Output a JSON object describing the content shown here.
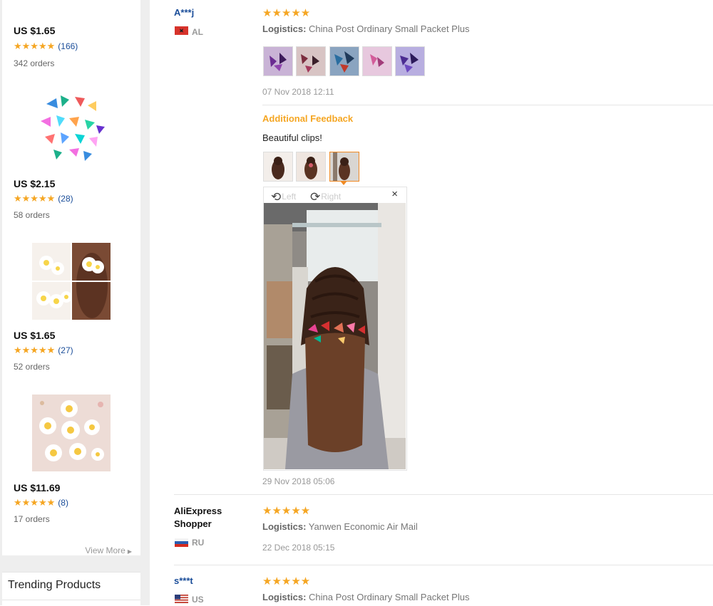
{
  "sidebar": {
    "products": [
      {
        "price": "US $1.65",
        "stars": "★★★★★",
        "review_count": "(166)",
        "orders": "342 orders"
      },
      {
        "price": "US $2.15",
        "stars": "★★★★★",
        "review_count": "(28)",
        "orders": "58 orders"
      },
      {
        "price": "US $1.65",
        "stars": "★★★★★",
        "review_count": "(27)",
        "orders": "52 orders"
      },
      {
        "price": "US $11.69",
        "stars": "★★★★★",
        "review_count": "(8)",
        "orders": "17 orders"
      }
    ],
    "view_more": "View More",
    "trending_title": "Trending Products"
  },
  "reviews": [
    {
      "name": "A***j",
      "country": "AL",
      "stars": "★★★★★",
      "logistics_label": "Logistics:",
      "logistics": "China Post Ordinary Small Packet Plus",
      "date": "07 Nov 2018 12:11",
      "additional_feedback_label": "Additional Feedback",
      "additional_text": "Beautiful clips!",
      "viewer": {
        "left_label": "Left",
        "right_label": "Right",
        "close": "×"
      },
      "additional_date": "29 Nov 2018 05:06"
    },
    {
      "name": "AliExpress Shopper",
      "country": "RU",
      "stars": "★★★★★",
      "logistics_label": "Logistics:",
      "logistics": "Yanwen Economic Air Mail",
      "date": "22 Dec 2018 05:15"
    },
    {
      "name": "s***t",
      "country": "US",
      "stars": "★★★★★",
      "logistics_label": "Logistics:",
      "logistics": "China Post Ordinary Small Packet Plus"
    }
  ],
  "colors": {
    "star": "#f5a623",
    "name_link": "#1a4d99",
    "accent_orange": "#f08a24"
  }
}
